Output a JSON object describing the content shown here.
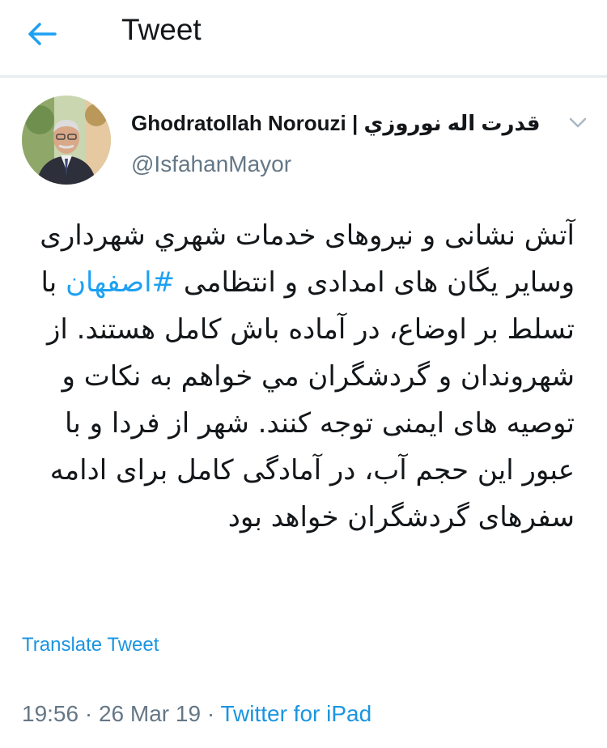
{
  "header": {
    "back_icon": "arrow-left-icon",
    "title": "Tweet"
  },
  "author": {
    "name_en": "Ghodratollah Norouzi",
    "separator": "|",
    "name_fa": "قدرت اله نوروزي",
    "handle": "@IsfahanMayor",
    "menu_icon": "chevron-down-icon"
  },
  "tweet": {
    "text_before": "آتش نشانی و نیروهای خدمات شهري شهرداری وسایر یگان های امدادی و انتظامی ",
    "hashtag": "#اصفهان",
    "text_after": " با تسلط بر اوضاع، در آماده باش کامل هستند. از شهروندان و گردشگران مي خواهم به نکات و توصیه های ایمنی توجه کنند. شهر از فردا و با عبور این حجم آب، در آمادگی کامل برای ادامه سفرهای گردشگران خواهد بود"
  },
  "translate_label": "Translate Tweet",
  "meta": {
    "time": "19:56",
    "dot1": " · ",
    "date": "26 Mar 19",
    "dot2": " · ",
    "source": "Twitter for iPad"
  },
  "colors": {
    "accent": "#1da1f2",
    "link": "#1b95e0",
    "secondary_text": "#657786",
    "divider": "#e6ecf0"
  }
}
